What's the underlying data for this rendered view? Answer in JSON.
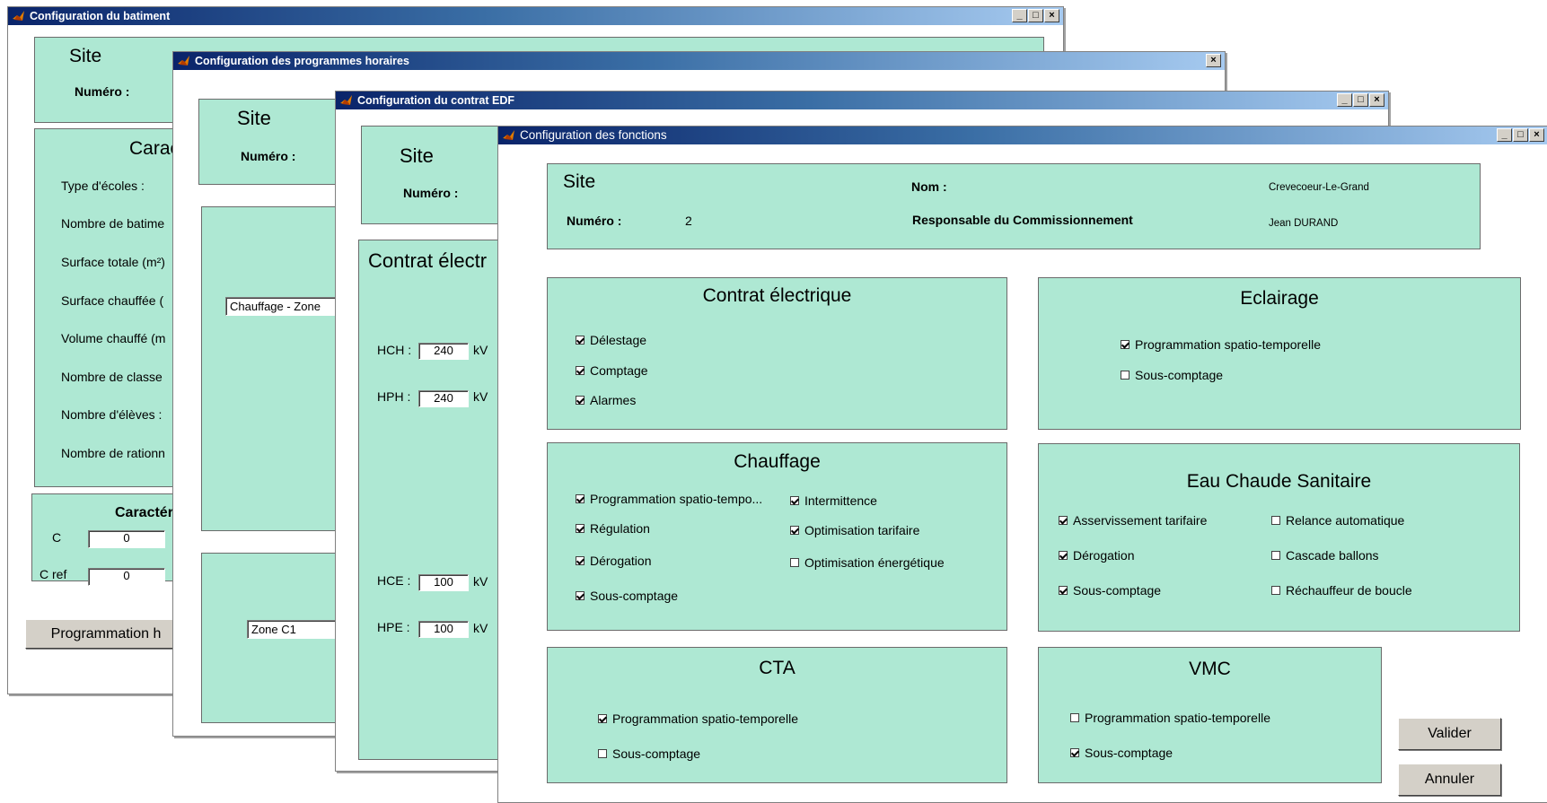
{
  "win_batiment": {
    "title": "Configuration du batiment",
    "site_label": "Site",
    "numero_label": "Numéro :",
    "carac_title": "Carac",
    "fields": [
      "Type  d'écoles :",
      "Nombre de batime",
      "Surface totale (m²)",
      "Surface chauffée (",
      "Volume chauffé (m",
      "Nombre de classe",
      "Nombre d'élèves :",
      "Nombre de rationn"
    ],
    "carac2_title": "Caractéri",
    "c_label": "C",
    "c_value": "0",
    "cref_label": "C ref",
    "cref_value": "0",
    "prog_button": "Programmation h"
  },
  "win_programmes": {
    "title": "Configuration des programmes horaires",
    "site_label": "Site",
    "numero_label": "Numéro :",
    "popup1": "Chauffage - Zone",
    "popup2": "Zone C1"
  },
  "win_edf": {
    "title": "Configuration du contrat EDF",
    "site_label": "Site",
    "numero_label": "Numéro :",
    "contrat_title": "Contrat électr",
    "hch_label": "HCH :",
    "hch_value": "240",
    "hph_label": "HPH :",
    "hph_value": "240",
    "hce_label": "HCE :",
    "hce_value": "100",
    "hpe_label": "HPE :",
    "hpe_value": "100",
    "unit": "kV"
  },
  "win_fonctions": {
    "title": "Configuration des fonctions",
    "site": {
      "title": "Site",
      "numero_label": "Numéro :",
      "numero_value": "2",
      "nom_label": "Nom :",
      "nom_value": "Crevecoeur-Le-Grand",
      "resp_label": "Responsable du Commissionnement",
      "resp_value": "Jean DURAND"
    },
    "contrat": {
      "title": "Contrat électrique",
      "items": [
        {
          "label": "Délestage",
          "checked": true
        },
        {
          "label": "Comptage",
          "checked": true
        },
        {
          "label": "Alarmes",
          "checked": true
        }
      ]
    },
    "eclairage": {
      "title": "Eclairage",
      "items": [
        {
          "label": "Programmation spatio-temporelle",
          "checked": true
        },
        {
          "label": "Sous-comptage",
          "checked": false
        }
      ]
    },
    "chauffage": {
      "title": "Chauffage",
      "items": [
        {
          "label": "Programmation spatio-tempo...",
          "checked": true
        },
        {
          "label": "Régulation",
          "checked": true
        },
        {
          "label": "Dérogation",
          "checked": true
        },
        {
          "label": "Sous-comptage",
          "checked": true
        },
        {
          "label": "Intermittence",
          "checked": true
        },
        {
          "label": "Optimisation tarifaire",
          "checked": true
        },
        {
          "label": "Optimisation énergétique",
          "checked": false
        }
      ]
    },
    "ecs": {
      "title": "Eau Chaude Sanitaire",
      "items": [
        {
          "label": "Asservissement tarifaire",
          "checked": true
        },
        {
          "label": "Dérogation",
          "checked": true
        },
        {
          "label": "Sous-comptage",
          "checked": true
        },
        {
          "label": "Relance automatique",
          "checked": false
        },
        {
          "label": "Cascade ballons",
          "checked": false
        },
        {
          "label": "Réchauffeur de boucle",
          "checked": false
        }
      ]
    },
    "cta": {
      "title": "CTA",
      "items": [
        {
          "label": "Programmation spatio-temporelle",
          "checked": true
        },
        {
          "label": "Sous-comptage",
          "checked": false
        }
      ]
    },
    "vmc": {
      "title": "VMC",
      "items": [
        {
          "label": "Programmation spatio-temporelle",
          "checked": false
        },
        {
          "label": "Sous-comptage",
          "checked": true
        }
      ]
    },
    "valider": "Valider",
    "annuler": "Annuler"
  },
  "titlebar_buttons": {
    "minimize": "_",
    "maximize": "□",
    "close": "×"
  },
  "colors": {
    "panel_bg": "#aee8d3",
    "titlebar_start": "#0a246a",
    "titlebar_end": "#a6caf0"
  }
}
